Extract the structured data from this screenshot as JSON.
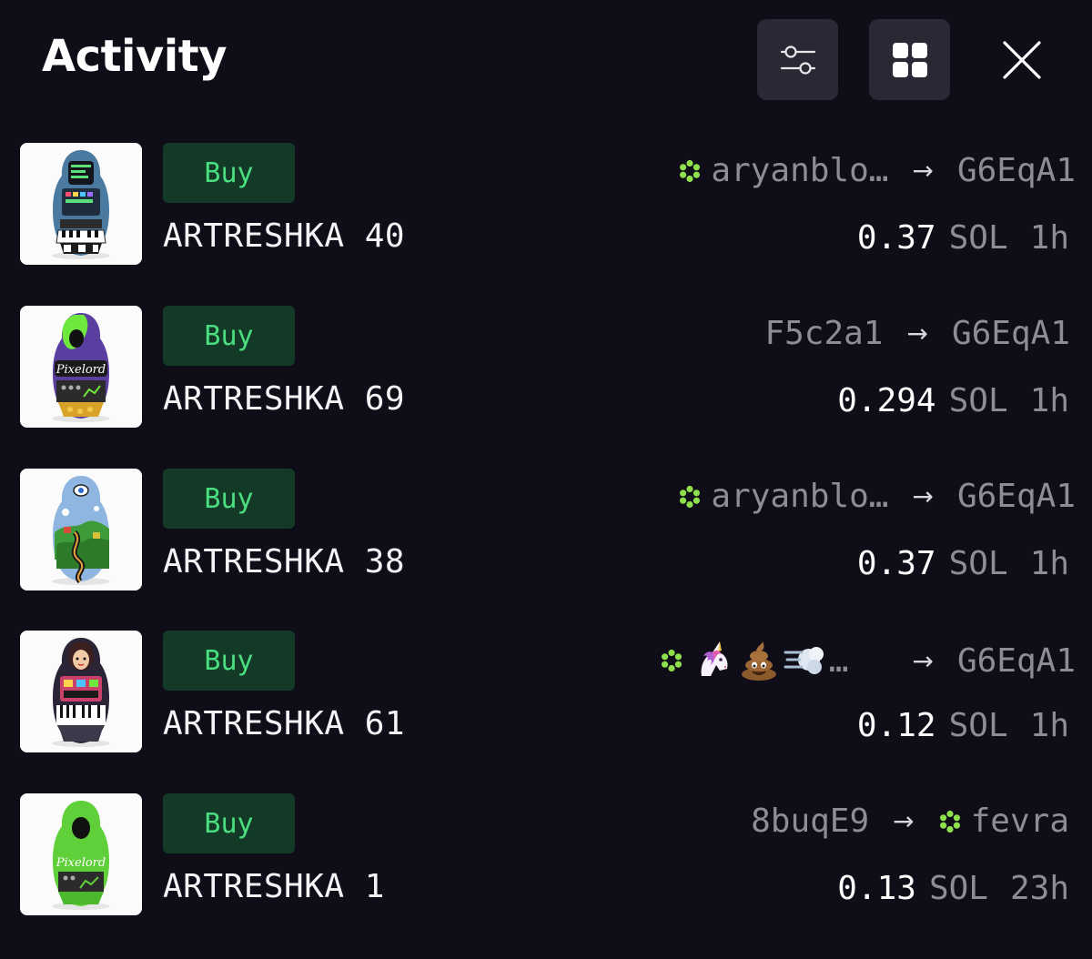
{
  "header": {
    "title": "Activity",
    "filter_icon": "sliders-icon",
    "grid_icon": "grid-view-icon",
    "close_icon": "close-icon"
  },
  "colors": {
    "background": "#0f0d18",
    "buy_badge_bg": "#133a27",
    "buy_badge_text": "#4ade80",
    "muted_text": "#8e8c96",
    "verified_icon": "#8ee04d"
  },
  "activities": [
    {
      "type": "Buy",
      "name": "ARTRESHKA 40",
      "from": "aryanblo…",
      "from_verified": true,
      "to": "G6EqA1",
      "to_verified": false,
      "amount": "0.37",
      "unit": "SOL",
      "age": "1h",
      "thumb": "matryoshka-computer"
    },
    {
      "type": "Buy",
      "name": "ARTRESHKA 69",
      "from": "F5c2a1",
      "from_verified": false,
      "to": "G6EqA1",
      "to_verified": false,
      "amount": "0.294",
      "unit": "SOL",
      "age": "1h",
      "thumb": "matryoshka-pixelord-purple"
    },
    {
      "type": "Buy",
      "name": "ARTRESHKA 38",
      "from": "aryanblo…",
      "from_verified": true,
      "to": "G6EqA1",
      "to_verified": false,
      "amount": "0.37",
      "unit": "SOL",
      "age": "1h",
      "thumb": "matryoshka-landscape"
    },
    {
      "type": "Buy",
      "name": "ARTRESHKA 61",
      "from": "…",
      "from_emoji": [
        "unicorn-emoji",
        "poo-emoji",
        "dash-emoji"
      ],
      "from_verified": true,
      "to": "G6EqA1",
      "to_verified": false,
      "amount": "0.12",
      "unit": "SOL",
      "age": "1h",
      "thumb": "matryoshka-folk"
    },
    {
      "type": "Buy",
      "name": "ARTRESHKA 1",
      "from": "8buqE9",
      "from_verified": false,
      "to": "fevra",
      "to_verified": true,
      "amount": "0.13",
      "unit": "SOL",
      "age": "23h",
      "thumb": "matryoshka-pixelord-green"
    }
  ]
}
